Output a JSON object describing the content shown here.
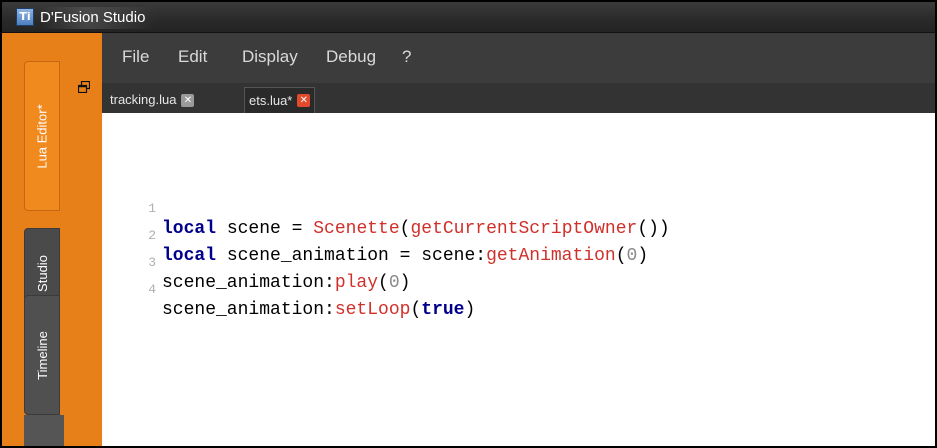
{
  "window": {
    "icon_label": "Ti",
    "title": "D'Fusion Studio"
  },
  "dock": {
    "tabs": [
      {
        "label": "Lua Editor*",
        "active": true
      },
      {
        "label": "Studio",
        "active": false
      },
      {
        "label": "Timeline",
        "active": false
      }
    ],
    "float_icon": "restore-icon"
  },
  "menu": {
    "items": [
      "File",
      "Edit",
      "Display",
      "Debug",
      "?"
    ]
  },
  "file_tabs": [
    {
      "label": "tracking.lua",
      "close": "✕",
      "active": false
    },
    {
      "label": "ets.lua*",
      "close": "✕",
      "active": true
    }
  ],
  "code": {
    "lines": [
      {
        "n": "1",
        "kw": "local",
        "a": " scene = ",
        "fn": "Scenette",
        "b": "(",
        "fn2": "getCurrentScriptOwner",
        "c": "())"
      },
      {
        "n": "2",
        "kw": "local",
        "a": " scene_animation = scene:",
        "fn": "getAnimation",
        "b": "(",
        "num": "0",
        "c": ")"
      },
      {
        "n": "3",
        "a": "scene_animation:",
        "fn": "play",
        "b": "(",
        "num": "0",
        "c": ")"
      },
      {
        "n": "4",
        "a": "scene_animation:",
        "fn": "setLoop",
        "b": "(",
        "kw2": "true",
        "c": ")"
      }
    ]
  },
  "colors": {
    "accent_orange": "#e8801a",
    "keyword_blue": "#00008b",
    "function_red": "#d0302a",
    "number_gray": "#8a8a8a",
    "menubar_dark": "#3c3c3c"
  }
}
